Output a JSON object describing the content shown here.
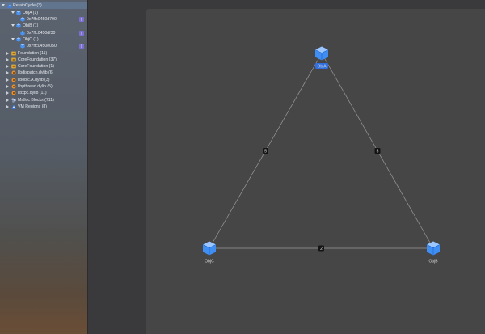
{
  "sidebar": {
    "items": [
      {
        "label": "RetainCycle",
        "count": "(3)",
        "icon": "person-blue-icon",
        "expanded": true,
        "selected": true
      },
      {
        "label": "ObjA",
        "count": "(1)",
        "icon": "cube-icon",
        "expanded": true
      },
      {
        "label": "0x7ffc0450d700",
        "icon": "cube-icon",
        "badge": "▯"
      },
      {
        "label": "ObjB",
        "count": "(1)",
        "icon": "cube-icon",
        "expanded": true
      },
      {
        "label": "0x7ffc0450df30",
        "icon": "cube-icon",
        "badge": "▯"
      },
      {
        "label": "ObjC",
        "count": "(1)",
        "icon": "cube-icon",
        "expanded": true
      },
      {
        "label": "0x7ffc0450e050",
        "icon": "cube-icon",
        "badge": "▯"
      },
      {
        "label": "Foundation",
        "count": "(11)",
        "icon": "folder-yellow-icon"
      },
      {
        "label": "CoreFoundation",
        "count": "(37)",
        "icon": "folder-yellow-icon"
      },
      {
        "label": "CoreFoundation",
        "count": "(1)",
        "icon": "folder-yellow-icon"
      },
      {
        "label": "libdispatch.dylib",
        "count": "(6)",
        "icon": "gear-orange-icon"
      },
      {
        "label": "libobjc.A.dylib",
        "count": "(3)",
        "icon": "gear-orange-icon"
      },
      {
        "label": "libpthread.dylib",
        "count": "(5)",
        "icon": "gear-orange-icon"
      },
      {
        "label": "libxpc.dylib",
        "count": "(11)",
        "icon": "gear-orange-icon"
      },
      {
        "label": "Malloc Blocks",
        "count": "(711)",
        "icon": "blocks-icon"
      },
      {
        "label": "VM Regions",
        "count": "(8)",
        "icon": "person-blue-icon"
      }
    ]
  },
  "graph": {
    "nodes": [
      {
        "id": "ObjA",
        "label": "ObjA",
        "selected": true
      },
      {
        "id": "ObjB",
        "label": "ObjB"
      },
      {
        "id": "ObjC",
        "label": "ObjC"
      }
    ],
    "edges": [
      {
        "from": "ObjA",
        "to": "ObjB",
        "label": "5"
      },
      {
        "from": "ObjA",
        "to": "ObjC",
        "label": "5"
      },
      {
        "from": "ObjB",
        "to": "ObjC",
        "label": "2"
      }
    ]
  },
  "colors": {
    "selection": "#62758e",
    "node_blue": "#3f8ef4",
    "selected_label_bg": "#2f6fe0",
    "edge": "#9a9a9a",
    "graph_bg": "#464646"
  }
}
